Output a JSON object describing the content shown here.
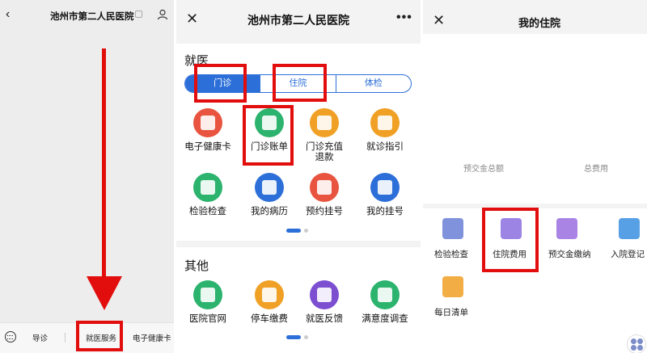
{
  "panel1": {
    "title": "池州市第二人民医院",
    "back_glyph": "‹",
    "bottom_menu": [
      "导诊",
      "就医服务",
      "电子健康卡"
    ]
  },
  "panel2": {
    "title": "池州市第二人民医院",
    "close_glyph": "✕",
    "more_glyph": "•••",
    "section1_title": "就医",
    "tabs": [
      "门诊",
      "住院",
      "体检"
    ],
    "tiles1": [
      {
        "label": "电子健康卡",
        "icon": "card-icon",
        "color": "#e8543f"
      },
      {
        "label": "门诊账单",
        "icon": "bill-icon",
        "color": "#2cb36e"
      },
      {
        "label": "门诊充值退款",
        "icon": "yuan-icon",
        "color": "#f0a024"
      },
      {
        "label": "就诊指引",
        "icon": "guide-icon",
        "color": "#f0a024"
      },
      {
        "label": "检验检查",
        "icon": "test-icon",
        "color": "#2cb36e"
      },
      {
        "label": "我的病历",
        "icon": "record-icon",
        "color": "#2d6fd8"
      },
      {
        "label": "预约挂号",
        "icon": "calendar-icon",
        "color": "#e8543f"
      },
      {
        "label": "我的挂号",
        "icon": "register-icon",
        "color": "#2d6fd8"
      }
    ],
    "section2_title": "其他",
    "tiles2": [
      {
        "label": "医院官网",
        "icon": "website-icon",
        "color": "#2cb36e"
      },
      {
        "label": "停车缴费",
        "icon": "parking-icon",
        "color": "#f0a024"
      },
      {
        "label": "就医反馈",
        "icon": "feedback-icon",
        "color": "#7b4fd0"
      },
      {
        "label": "满意度调查",
        "icon": "survey-icon",
        "color": "#2cb36e"
      }
    ]
  },
  "panel3": {
    "title": "我的住院",
    "close_glyph": "✕",
    "deposit_total_label": "预交金总额",
    "total_cost_label": "总费用",
    "services": [
      {
        "label": "检验检查",
        "icon": "chart-icon",
        "color": "#6b7fd6"
      },
      {
        "label": "住院费用",
        "icon": "bed-icon",
        "color": "#8b6fe0"
      },
      {
        "label": "预交金缴纳",
        "icon": "wallet-icon",
        "color": "#9b6fe0"
      },
      {
        "label": "入院登记",
        "icon": "register-icon",
        "color": "#3a8fe0"
      },
      {
        "label": "每日清单",
        "icon": "list-icon",
        "color": "#f0a024"
      }
    ]
  }
}
